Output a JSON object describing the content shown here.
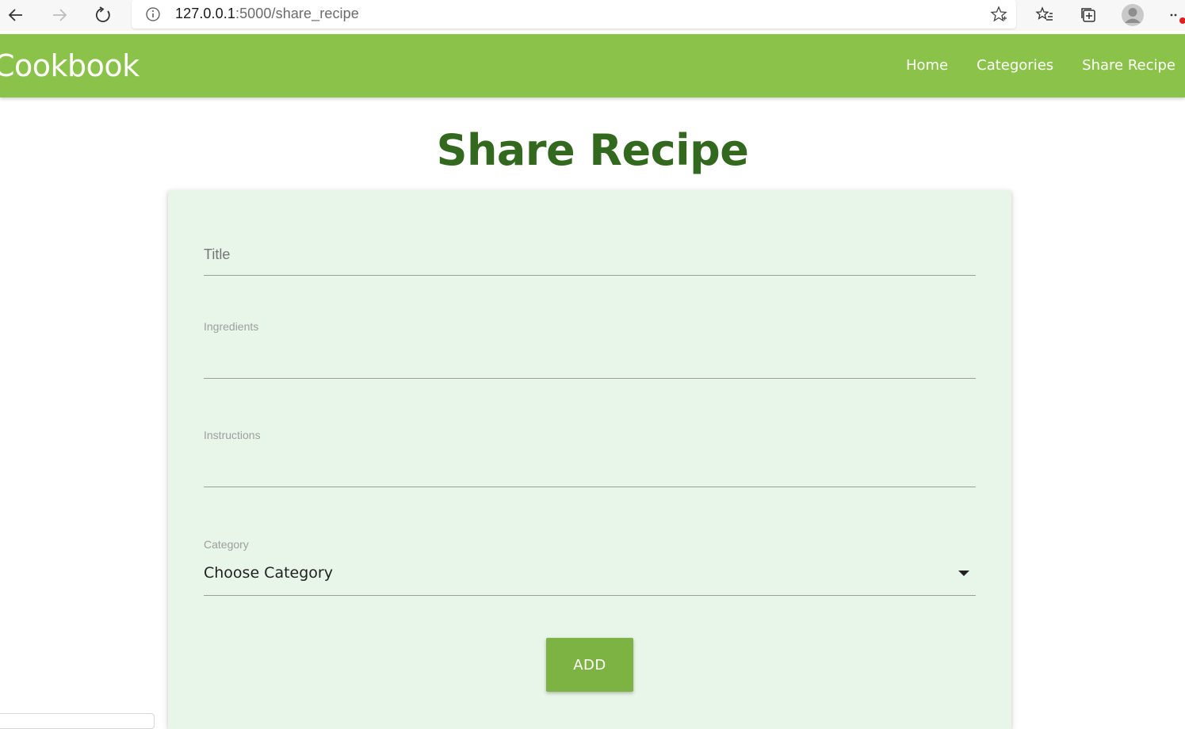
{
  "browser": {
    "url_host": "127.0.0.1",
    "url_path": ":5000/share_recipe",
    "icons": [
      "back-icon",
      "forward-icon",
      "refresh-icon",
      "info-icon",
      "star-icon",
      "favorites-icon",
      "collections-icon",
      "profile-icon",
      "more-icon"
    ]
  },
  "navbar": {
    "brand": "Cookbook",
    "links": [
      {
        "label": "Home"
      },
      {
        "label": "Categories"
      },
      {
        "label": "Share Recipe"
      }
    ]
  },
  "page": {
    "title": "Share Recipe"
  },
  "form": {
    "title_placeholder": "Title",
    "ingredients_label": "Ingredients",
    "instructions_label": "Instructions",
    "category_label": "Category",
    "category_value": "Choose Category",
    "submit_label": "ADD"
  },
  "colors": {
    "navbar": "#8bc34a",
    "title": "#33691e",
    "card": "#e8f5e9",
    "button": "#7cb342"
  }
}
